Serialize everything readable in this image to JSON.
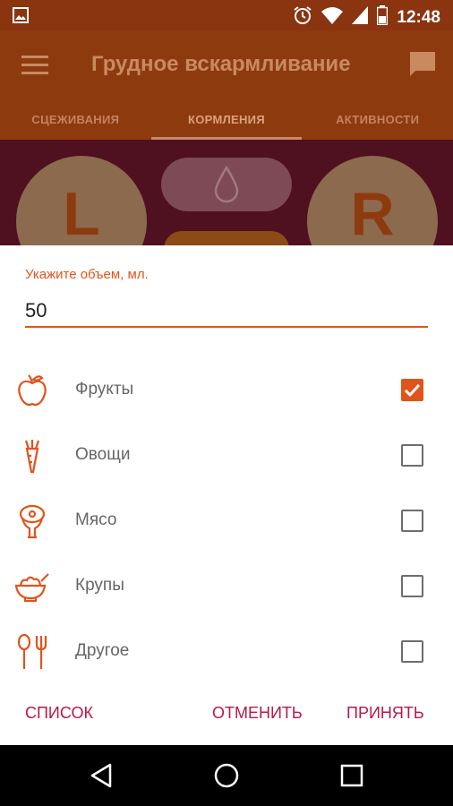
{
  "status_bar": {
    "time": "12:48",
    "icons": [
      "image-icon",
      "alarm-icon",
      "wifi-icon",
      "signal-icon",
      "battery-icon"
    ]
  },
  "app_bar": {
    "title": "Грудное вскармливание",
    "menu_icon": "menu-icon",
    "chat_icon": "chat-icon"
  },
  "tabs": [
    {
      "label": "СЦЕЖИВАНИЯ",
      "active": false
    },
    {
      "label": "КОРМЛЕНИЯ",
      "active": true
    },
    {
      "label": "АКТИВНОСТИ",
      "active": false
    }
  ],
  "background": {
    "left_letter": "L",
    "right_letter": "R"
  },
  "dialog": {
    "volume_label": "Укажите объем, мл.",
    "volume_value": "50",
    "items": [
      {
        "label": "Фрукты",
        "icon": "apple-icon",
        "checked": true
      },
      {
        "label": "Овощи",
        "icon": "carrot-icon",
        "checked": false
      },
      {
        "label": "Мясо",
        "icon": "meat-icon",
        "checked": false
      },
      {
        "label": "Крупы",
        "icon": "porridge-bowl-icon",
        "checked": false
      },
      {
        "label": "Другое",
        "icon": "spoon-fork-icon",
        "checked": false
      }
    ],
    "buttons": {
      "list": "СПИСОК",
      "cancel": "ОТМЕНИТЬ",
      "accept": "ПРИНЯТЬ"
    }
  },
  "colors": {
    "accent": "#e0541c",
    "button_text": "#b7194a",
    "app_bar": "#8e3a0f"
  },
  "nav_bar": {
    "icons": [
      "back-icon",
      "home-icon",
      "recents-icon"
    ]
  }
}
